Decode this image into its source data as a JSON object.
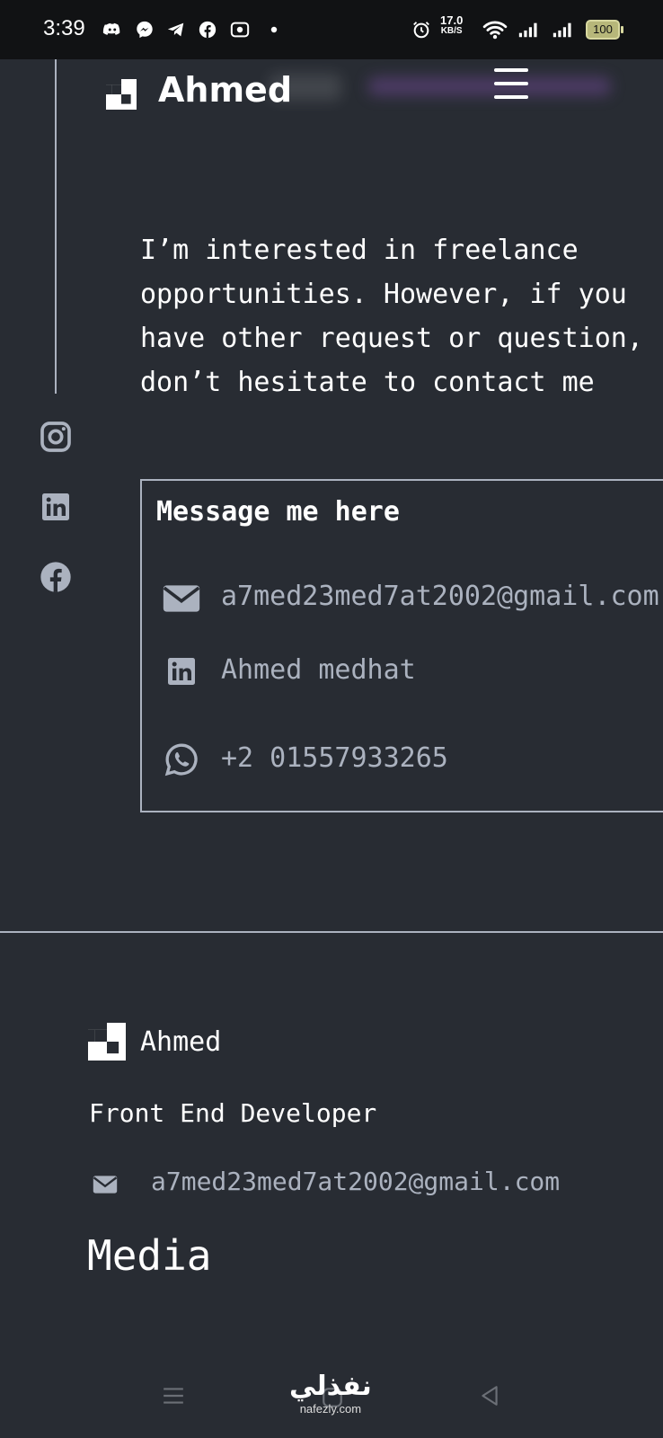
{
  "status_bar": {
    "time": "3:39",
    "notification_icons": [
      "discord-icon",
      "messenger-icon",
      "telegram-icon",
      "facebook-icon",
      "screen-record-icon",
      "dot-icon"
    ],
    "speed_value": "17.0",
    "speed_unit": "KB/S",
    "battery": "100"
  },
  "header": {
    "brand": "Ahmed",
    "menu_icon": "hamburger-icon"
  },
  "intro": {
    "text": "I’m interested in freelance opportunities. However, if you have other request or question, don’t hesitate to contact me"
  },
  "side_social": [
    "instagram-icon",
    "linkedin-icon",
    "facebook-icon"
  ],
  "contact": {
    "title": "Message me here",
    "email": "a7med23med7at2002@gmail.com",
    "linkedin": "Ahmed medhat",
    "whatsapp": "+2 01557933265"
  },
  "footer": {
    "brand": "Ahmed",
    "role": "Front End Developer",
    "email": "a7med23med7at2002@gmail.com",
    "media_heading": "Media"
  },
  "watermark": {
    "arabic": "نفذلي",
    "latin": "nafezly.com"
  },
  "colors": {
    "background": "#282c33",
    "text": "#ffffff",
    "muted": "#abb2bf",
    "status_bar": "#111214"
  }
}
